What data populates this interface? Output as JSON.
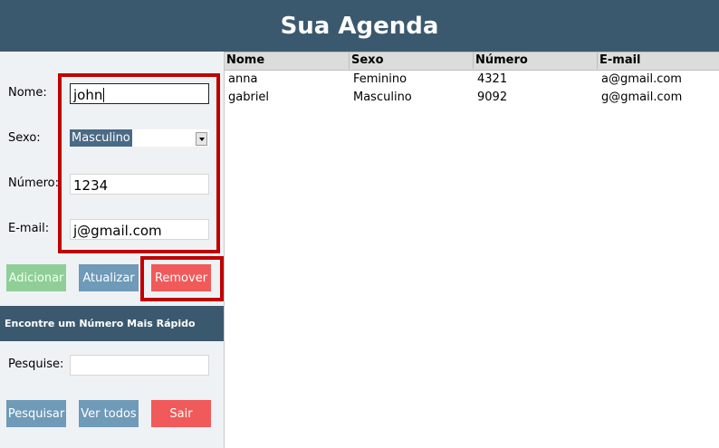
{
  "header": {
    "title": "Sua Agenda"
  },
  "form": {
    "nome_label": "Nome:",
    "nome_value": "john",
    "sexo_label": "Sexo:",
    "sexo_value": "Masculino",
    "numero_label": "Número:",
    "numero_value": "1234",
    "email_label": "E-mail:",
    "email_value": "j@gmail.com"
  },
  "actions": {
    "adicionar": "Adicionar",
    "atualizar": "Atualizar",
    "remover": "Remover"
  },
  "search": {
    "section_title": "Encontre um Número Mais Rápido",
    "label": "Pesquise:",
    "value": "",
    "pesquisar": "Pesquisar",
    "ver_todos": "Ver todos",
    "sair": "Sair"
  },
  "table": {
    "columns": [
      "Nome",
      "Sexo",
      "Número",
      "E-mail"
    ],
    "rows": [
      [
        "anna",
        "Feminino",
        "4321",
        "a@gmail.com"
      ],
      [
        "gabriel",
        "Masculino",
        "9092",
        "g@gmail.com"
      ]
    ]
  },
  "colors": {
    "header_bg": "#3b596e",
    "adicionar_bg": "#8fcf97",
    "atualizar_bg": "#6f9ab8",
    "remover_bg": "#f05a5a",
    "highlight": "#c00000"
  }
}
